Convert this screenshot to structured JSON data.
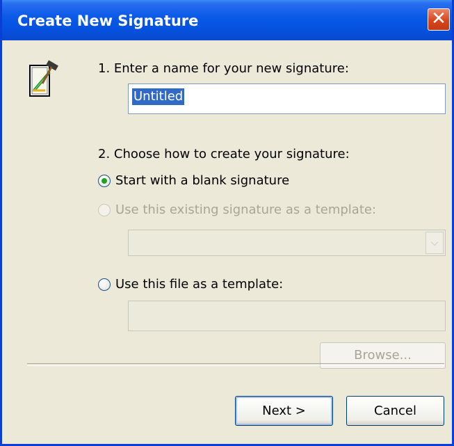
{
  "window": {
    "title": "Create New Signature",
    "close_glyph": "✕"
  },
  "step1": {
    "label": "1. Enter a name for your new signature:",
    "name_value": "Untitled"
  },
  "step2": {
    "label": "2. Choose how to create your signature:",
    "options": [
      {
        "label": "Start with a blank signature",
        "selected": true,
        "enabled": true
      },
      {
        "label": "Use this existing signature as a template:",
        "selected": false,
        "enabled": false
      },
      {
        "label": "Use this file as a template:",
        "selected": false,
        "enabled": true
      }
    ],
    "template_dropdown_value": "",
    "file_path_value": "",
    "browse_label": "Browse..."
  },
  "buttons": {
    "next": "Next >",
    "cancel": "Cancel"
  },
  "colors": {
    "titlebar": "#0552e0",
    "close": "#d8451c",
    "selection": "#316ac5",
    "radio_dot": "#21a121",
    "dialog_bg": "#ece9d8"
  }
}
